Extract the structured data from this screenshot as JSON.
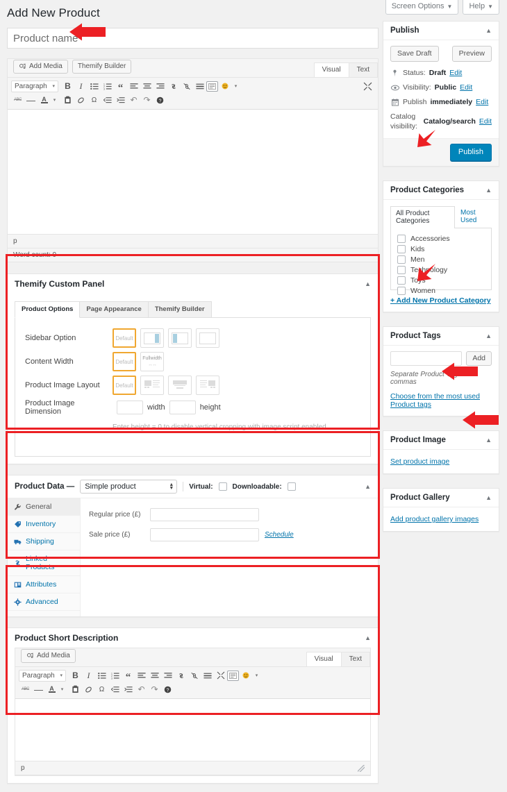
{
  "topbar": {
    "screen_options": "Screen Options",
    "help": "Help",
    "caret": "▼"
  },
  "page": {
    "title": "Add New Product"
  },
  "title_field": {
    "placeholder": "Product name",
    "value": ""
  },
  "editor": {
    "add_media": "Add Media",
    "themify_builder": "Themify Builder",
    "tab_visual": "Visual",
    "tab_text": "Text",
    "format_select": "Paragraph",
    "caret": "▾",
    "path": "p",
    "word_count": "Word count: 0",
    "toolbar_row1": [
      {
        "name": "bold-icon",
        "glyph": "B"
      },
      {
        "name": "italic-icon",
        "glyph": "I"
      },
      {
        "name": "bulleted-list-icon",
        "glyph": "≡"
      },
      {
        "name": "numbered-list-icon",
        "glyph": "≣"
      },
      {
        "name": "blockquote-icon",
        "glyph": "“"
      },
      {
        "name": "align-left-icon",
        "glyph": "☰"
      },
      {
        "name": "align-center-icon",
        "glyph": "☰"
      },
      {
        "name": "align-right-icon",
        "glyph": "☰"
      },
      {
        "name": "insert-link-icon",
        "glyph": "🔗"
      },
      {
        "name": "remove-link-icon",
        "glyph": "🔗"
      },
      {
        "name": "read-more-icon",
        "glyph": "☰"
      },
      {
        "name": "toolbar-toggle-icon",
        "glyph": "⌸"
      },
      {
        "name": "emoji-icon",
        "glyph": "🙂"
      }
    ],
    "toolbar_row2": [
      {
        "name": "strikethrough-icon",
        "glyph": "ABC"
      },
      {
        "name": "horizontal-line-icon",
        "glyph": "—"
      },
      {
        "name": "text-color-icon",
        "glyph": "A"
      },
      {
        "name": "paste-as-text-icon",
        "glyph": "📋"
      },
      {
        "name": "clear-formatting-icon",
        "glyph": "⊘"
      },
      {
        "name": "special-character-icon",
        "glyph": "Ω"
      },
      {
        "name": "decrease-indent-icon",
        "glyph": "⇤"
      },
      {
        "name": "increase-indent-icon",
        "glyph": "⇥"
      },
      {
        "name": "undo-icon",
        "glyph": "↶"
      },
      {
        "name": "redo-icon",
        "glyph": "↷"
      },
      {
        "name": "keyboard-shortcuts-icon",
        "glyph": "?"
      }
    ],
    "fullscreen_icon": "⤡"
  },
  "themify_panel": {
    "title": "Themify Custom Panel",
    "toggle": "▲",
    "tabs": [
      {
        "label": "Product Options",
        "active": true
      },
      {
        "label": "Page Appearance",
        "active": false
      },
      {
        "label": "Themify Builder",
        "active": false
      }
    ],
    "sidebar_option": {
      "label": "Sidebar Option",
      "default_text": "Default",
      "choices": [
        "default",
        "sidebar-right",
        "sidebar-left",
        "no-sidebar"
      ]
    },
    "content_width": {
      "label": "Content Width",
      "default_text": "Default",
      "fullwidth_text": "Fullwidth"
    },
    "product_image_layout": {
      "label": "Product Image Layout",
      "default_text": "Default",
      "choices": [
        "default",
        "image-left",
        "image-top",
        "image-right"
      ]
    },
    "product_image_dimension": {
      "label": "Product Image Dimension",
      "width_label": "width",
      "height_label": "height",
      "width_value": "",
      "height_value": "",
      "note": "Enter height = 0 to disable vertical cropping with image script enabled"
    }
  },
  "product_data": {
    "title": "Product Data —",
    "type_selected": "Simple product",
    "virtual_label": "Virtual:",
    "virtual_checked": false,
    "downloadable_label": "Downloadable:",
    "downloadable_checked": false,
    "toggle": "▲",
    "tabs": [
      {
        "label": "General",
        "icon": "wrench-icon",
        "glyph": "🔧",
        "active": true
      },
      {
        "label": "Inventory",
        "icon": "tag-icon",
        "glyph": "◆",
        "active": false
      },
      {
        "label": "Shipping",
        "icon": "truck-icon",
        "glyph": "▬",
        "active": false
      },
      {
        "label": "Linked Products",
        "icon": "link-icon",
        "glyph": "🔗",
        "active": false
      },
      {
        "label": "Attributes",
        "icon": "grid-icon",
        "glyph": "▦",
        "active": false
      },
      {
        "label": "Advanced",
        "icon": "gear-icon",
        "glyph": "⚙",
        "active": false
      }
    ],
    "fields": [
      {
        "label": "Regular price (£)",
        "value": "",
        "link": ""
      },
      {
        "label": "Sale price (£)",
        "value": "",
        "link": "Schedule"
      }
    ]
  },
  "short_description": {
    "title": "Product Short Description",
    "toggle": "▲",
    "add_media": "Add Media",
    "tab_visual": "Visual",
    "tab_text": "Text",
    "format_select": "Paragraph",
    "path": "p",
    "toolbar_row1": [
      {
        "name": "bold-icon",
        "glyph": "B"
      },
      {
        "name": "italic-icon",
        "glyph": "I"
      },
      {
        "name": "bulleted-list-icon",
        "glyph": "≡"
      },
      {
        "name": "numbered-list-icon",
        "glyph": "≣"
      },
      {
        "name": "blockquote-icon",
        "glyph": "“"
      },
      {
        "name": "align-left-icon",
        "glyph": "☰"
      },
      {
        "name": "align-center-icon",
        "glyph": "☰"
      },
      {
        "name": "align-right-icon",
        "glyph": "☰"
      },
      {
        "name": "insert-link-icon",
        "glyph": "🔗"
      },
      {
        "name": "remove-link-icon",
        "glyph": "🔗"
      },
      {
        "name": "read-more-icon",
        "glyph": "☰"
      },
      {
        "name": "fullscreen-icon",
        "glyph": "⤡"
      },
      {
        "name": "toolbar-toggle-icon",
        "glyph": "⌸"
      },
      {
        "name": "emoji-icon",
        "glyph": "🙂"
      }
    ],
    "toolbar_row2": [
      {
        "name": "strikethrough-icon",
        "glyph": "ABC"
      },
      {
        "name": "horizontal-line-icon",
        "glyph": "—"
      },
      {
        "name": "text-color-icon",
        "glyph": "A"
      },
      {
        "name": "paste-as-text-icon",
        "glyph": "📋"
      },
      {
        "name": "clear-formatting-icon",
        "glyph": "⊘"
      },
      {
        "name": "special-character-icon",
        "glyph": "Ω"
      },
      {
        "name": "decrease-indent-icon",
        "glyph": "⇤"
      },
      {
        "name": "increase-indent-icon",
        "glyph": "⇥"
      },
      {
        "name": "undo-icon",
        "glyph": "↶"
      },
      {
        "name": "redo-icon",
        "glyph": "↷"
      },
      {
        "name": "keyboard-shortcuts-icon",
        "glyph": "?"
      }
    ]
  },
  "publish": {
    "title": "Publish",
    "toggle": "▲",
    "save_draft": "Save Draft",
    "preview": "Preview",
    "status_label": "Status:",
    "status_value": "Draft",
    "visibility_label": "Visibility:",
    "visibility_value": "Public",
    "publish_label": "Publish",
    "publish_value": "immediately",
    "catalog_label": "Catalog visibility:",
    "catalog_value": "Catalog/search",
    "edit": "Edit",
    "publish_button": "Publish"
  },
  "product_categories": {
    "title": "Product Categories",
    "toggle": "▲",
    "tabs": [
      {
        "label": "All Product Categories",
        "active": true
      },
      {
        "label": "Most Used",
        "active": false
      }
    ],
    "items": [
      {
        "label": "Accessories",
        "checked": false
      },
      {
        "label": "Kids",
        "checked": false
      },
      {
        "label": "Men",
        "checked": false
      },
      {
        "label": "Technology",
        "checked": false
      },
      {
        "label": "Toys",
        "checked": false
      },
      {
        "label": "Women",
        "checked": false
      }
    ],
    "add_new": "+ Add New Product Category"
  },
  "product_tags": {
    "title": "Product Tags",
    "toggle": "▲",
    "input_value": "",
    "add_button": "Add",
    "note": "Separate Product Tags with commas",
    "most_used_link": "Choose from the most used Product tags"
  },
  "product_image": {
    "title": "Product Image",
    "toggle": "▲",
    "link": "Set product image"
  },
  "product_gallery": {
    "title": "Product Gallery",
    "toggle": "▲",
    "link": "Add product gallery images"
  },
  "annotations": {
    "arrow_color": "#ec2024",
    "box_color": "#ec2024",
    "arrows": [
      {
        "name": "arrow-product-name",
        "direction": "left"
      },
      {
        "name": "arrow-publish-button",
        "direction": "down"
      },
      {
        "name": "arrow-product-categories",
        "direction": "down-left"
      },
      {
        "name": "arrow-product-tags",
        "direction": "down-left"
      },
      {
        "name": "arrow-set-product-image",
        "direction": "left"
      },
      {
        "name": "arrow-add-product-gallery",
        "direction": "left"
      }
    ],
    "boxes": [
      {
        "name": "highlight-themify-panel"
      },
      {
        "name": "highlight-product-data"
      },
      {
        "name": "highlight-short-description"
      }
    ]
  }
}
